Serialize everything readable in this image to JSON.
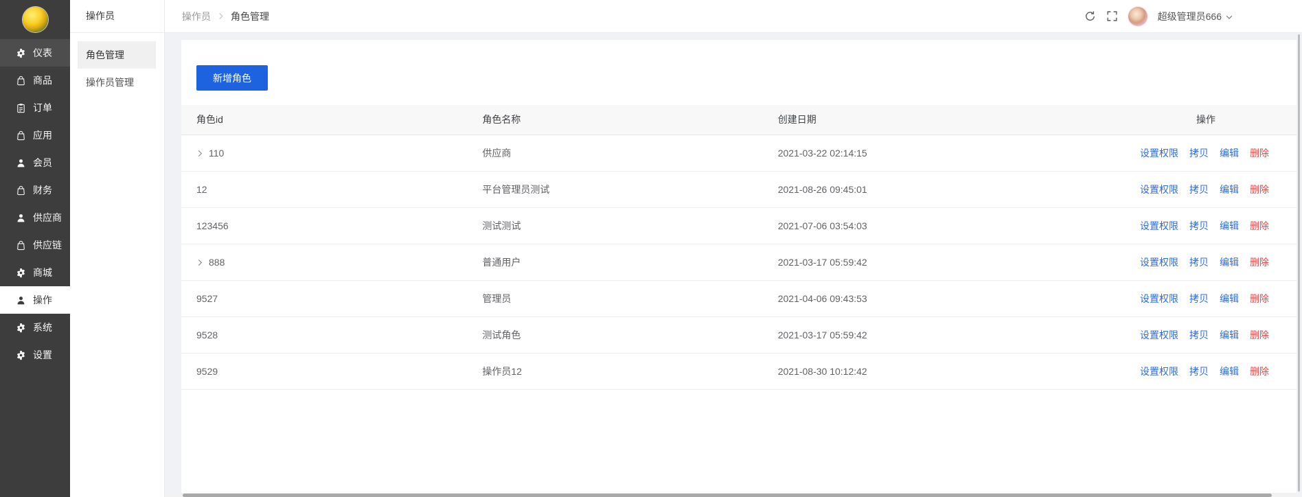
{
  "sidebar": {
    "items": [
      {
        "key": "dashboard",
        "icon": "gauge-icon",
        "label": "仪表",
        "state": "hover"
      },
      {
        "key": "goods",
        "icon": "bag-icon",
        "label": "商品",
        "state": ""
      },
      {
        "key": "orders",
        "icon": "order-icon",
        "label": "订单",
        "state": ""
      },
      {
        "key": "apps",
        "icon": "bag-icon",
        "label": "应用",
        "state": ""
      },
      {
        "key": "members",
        "icon": "user-icon",
        "label": "会员",
        "state": ""
      },
      {
        "key": "finance",
        "icon": "bag-icon",
        "label": "财务",
        "state": ""
      },
      {
        "key": "suppliers",
        "icon": "user-icon",
        "label": "供应商",
        "state": ""
      },
      {
        "key": "supply-chain",
        "icon": "bag-icon",
        "label": "供应链",
        "state": ""
      },
      {
        "key": "mall",
        "icon": "gear-icon",
        "label": "商城",
        "state": ""
      },
      {
        "key": "operations",
        "icon": "user-icon",
        "label": "操作",
        "state": "active"
      },
      {
        "key": "system",
        "icon": "gear-icon",
        "label": "系统",
        "state": ""
      },
      {
        "key": "settings",
        "icon": "gear-icon",
        "label": "设置",
        "state": ""
      }
    ]
  },
  "submenu": {
    "title": "操作员",
    "items": [
      {
        "key": "role-management",
        "label": "角色管理",
        "selected": true
      },
      {
        "key": "operator-management",
        "label": "操作员管理",
        "selected": false
      }
    ]
  },
  "breadcrumb": {
    "parent": "操作员",
    "current": "角色管理"
  },
  "topbar": {
    "user_name": "超级管理员666"
  },
  "toolbar": {
    "add_role_label": "新增角色"
  },
  "table": {
    "columns": [
      {
        "key": "role-id",
        "label": "角色id"
      },
      {
        "key": "role-name",
        "label": "角色名称"
      },
      {
        "key": "created-date",
        "label": "创建日期"
      },
      {
        "key": "operations",
        "label": "操作"
      }
    ],
    "actions": [
      {
        "key": "set-permissions",
        "label": "设置权限",
        "type": "link"
      },
      {
        "key": "copy",
        "label": "拷贝",
        "type": "link"
      },
      {
        "key": "edit",
        "label": "编辑",
        "type": "link"
      },
      {
        "key": "delete",
        "label": "删除",
        "type": "danger"
      }
    ],
    "rows": [
      {
        "id": "110",
        "expandable": true,
        "name": "供应商",
        "created": "2021-03-22 02:14:15"
      },
      {
        "id": "12",
        "expandable": false,
        "name": "平台管理员测试",
        "created": "2021-08-26 09:45:01"
      },
      {
        "id": "123456",
        "expandable": false,
        "name": "测试测试",
        "created": "2021-07-06 03:54:03"
      },
      {
        "id": "888",
        "expandable": true,
        "name": "普通用户",
        "created": "2021-03-17 05:59:42"
      },
      {
        "id": "9527",
        "expandable": false,
        "name": "管理员",
        "created": "2021-04-06 09:43:53"
      },
      {
        "id": "9528",
        "expandable": false,
        "name": "测试角色",
        "created": "2021-03-17 05:59:42"
      },
      {
        "id": "9529",
        "expandable": false,
        "name": "操作员12",
        "created": "2021-08-30 10:12:42"
      }
    ]
  },
  "colors": {
    "primary_button": "#1d63e0",
    "action_link": "#2f6bdc",
    "danger_link": "#ef4444",
    "sidebar_bg": "#3d3d3e",
    "content_bg": "#f0f2f5",
    "table_header_bg": "#f8f8f9"
  }
}
